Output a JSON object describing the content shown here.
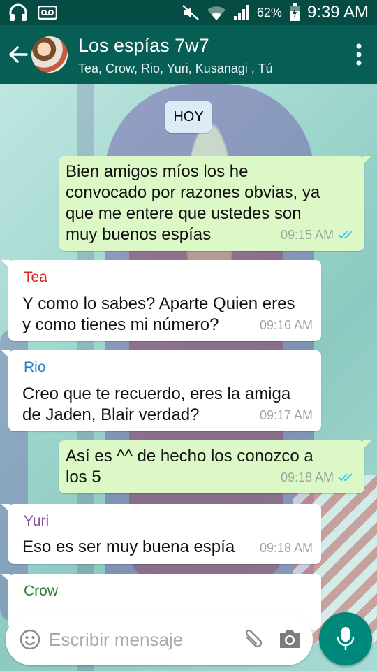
{
  "status_bar": {
    "left_icons": [
      "headphones-icon",
      "voicemail-icon"
    ],
    "right_icons": [
      "mute-icon",
      "wifi-icon",
      "signal-icon",
      "battery-icon"
    ],
    "battery": "62%",
    "time": "9:39 AM"
  },
  "header": {
    "title": "Los espías 7w7",
    "members": "Tea, Crow, Rio, Yuri, Kusanagi , Tú"
  },
  "colors": {
    "appbar": "#075e54",
    "statusbar": "#054d44",
    "outgoing_bubble": "#dcf8c6",
    "incoming_bubble": "#ffffff",
    "tea": "#e21b1b",
    "rio": "#1e7fc8",
    "yuri": "#8a4fa0",
    "crow": "#2e7d32",
    "read_ticks": "#4fc3f7",
    "mic_button": "#00897b"
  },
  "chat": {
    "date_label": "HOY",
    "messages": [
      {
        "direction": "out",
        "lines": [
          "Bien amigos míos los he",
          "convocado por razones obvias, ya",
          "que me entere que ustedes son",
          "muy buenos espías"
        ],
        "time": "09:15 AM",
        "read": true
      },
      {
        "direction": "in",
        "sender": "Tea",
        "lines": [
          "Y como lo sabes? Aparte Quien eres",
          "y como tienes mi número?"
        ],
        "time": "09:16 AM"
      },
      {
        "direction": "in",
        "sender": "Rio",
        "lines": [
          "Creo que te recuerdo, eres la amiga",
          "de Jaden, Blair verdad?"
        ],
        "time": "09:17 AM"
      },
      {
        "direction": "out",
        "lines": [
          "Así es ^^ de hecho los conozco a",
          "los 5"
        ],
        "time": "09:18 AM",
        "read": true
      },
      {
        "direction": "in",
        "sender": "Yuri",
        "lines": [
          "Eso es ser muy buena espía"
        ],
        "time": "09:18 AM"
      },
      {
        "direction": "in",
        "sender": "Crow",
        "lines": [],
        "time": ""
      }
    ]
  },
  "input": {
    "placeholder": "Escribir mensaje"
  }
}
